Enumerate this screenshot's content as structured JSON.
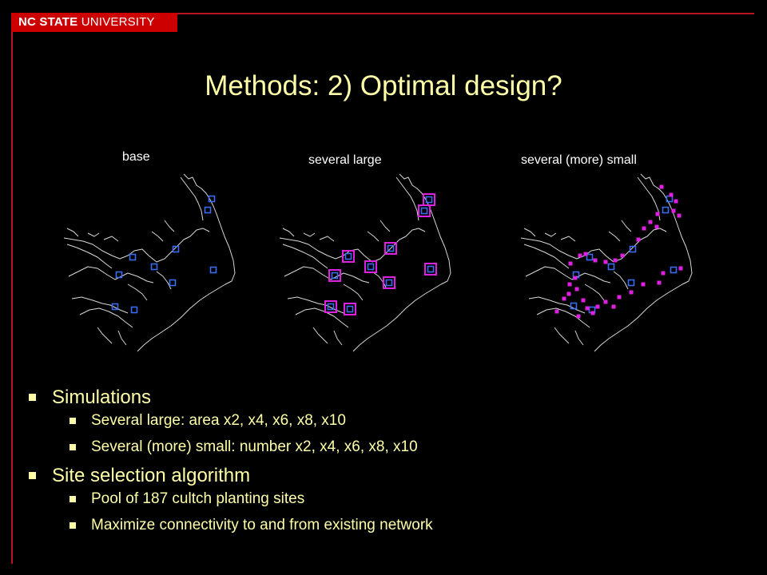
{
  "header": {
    "university_bold": "NC STATE",
    "university_rest": " UNIVERSITY"
  },
  "slide": {
    "title": "Methods: 2) Optimal design?"
  },
  "maps": [
    {
      "caption": "base"
    },
    {
      "caption": "several large"
    },
    {
      "caption": "several (more) small"
    }
  ],
  "colors": {
    "accent": "#cc0000",
    "title": "#ffffa8",
    "base_sites": "#3b6cf0",
    "added_sites": "#e020e0"
  },
  "bullets": [
    {
      "text": "Simulations",
      "level": 1
    },
    {
      "text": "Several large: area x2, x4, x6, x8, x10",
      "level": 2
    },
    {
      "text": "Several (more) small: number x2, x4, x6, x8, x10",
      "level": 2
    },
    {
      "text": "Site selection algorithm",
      "level": 1
    },
    {
      "text": "Pool of 187 cultch planting sites",
      "level": 2
    },
    {
      "text": "Maximize connectivity to and from existing network",
      "level": 2
    }
  ]
}
